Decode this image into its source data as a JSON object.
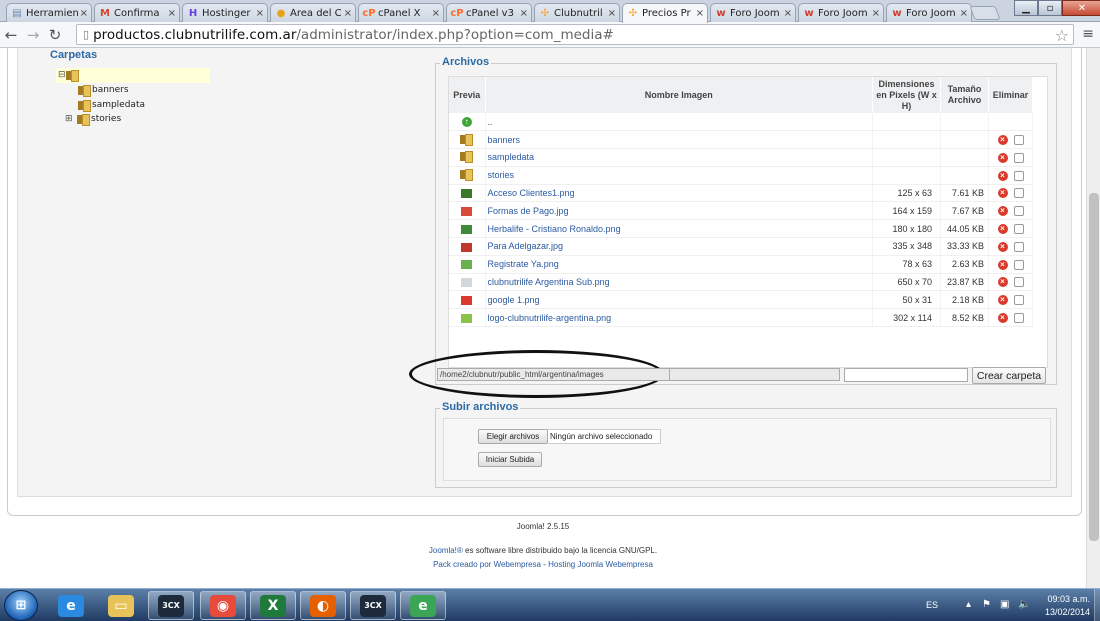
{
  "browser": {
    "tabs": [
      {
        "label": "Herramien",
        "icon": "page-icon",
        "color": "#6b88b5",
        "glyph": "▤"
      },
      {
        "label": "Confirma",
        "icon": "gmail-icon",
        "color": "#d14836",
        "glyph": "M"
      },
      {
        "label": "Hostinger",
        "icon": "hostinger-icon",
        "color": "#673de6",
        "glyph": "H"
      },
      {
        "label": "Área del C",
        "icon": "coin-icon",
        "color": "#e8a21a",
        "glyph": "●"
      },
      {
        "label": "cPanel X",
        "icon": "cpanel-icon",
        "color": "#ff6c2c",
        "glyph": "cP"
      },
      {
        "label": "cPanel v3",
        "icon": "cpanel-icon",
        "color": "#ff6c2c",
        "glyph": "cP"
      },
      {
        "label": "Clubnutril",
        "icon": "joomla-icon",
        "color": "#f9a541",
        "glyph": "✣"
      },
      {
        "label": "Precios Pr",
        "icon": "joomla-icon",
        "color": "#f9a541",
        "glyph": "✣"
      },
      {
        "label": "Foro Joom",
        "icon": "webempresa-icon",
        "color": "#d33b2f",
        "glyph": "w"
      },
      {
        "label": "Foro Joom",
        "icon": "webempresa-icon",
        "color": "#d33b2f",
        "glyph": "w"
      },
      {
        "label": "Foro Joom",
        "icon": "webempresa-icon",
        "color": "#d33b2f",
        "glyph": "w"
      }
    ],
    "url_domain": "productos.clubnutrilife.com.ar",
    "url_path": "/administrator/index.php?option=com_media#"
  },
  "media": {
    "folders_title": "Carpetas",
    "tree": [
      "banners",
      "sampledata",
      "stories"
    ],
    "files_title": "Archivos",
    "columns": {
      "preview": "Previa",
      "name": "Nombre Imagen",
      "dimensions": "Dimensiones en Pixels (W x H)",
      "size": "Tamaño Archivo",
      "delete": "Eliminar"
    },
    "up_label": "..",
    "files": [
      {
        "name": "banners",
        "type": "folder",
        "dim": "",
        "size": ""
      },
      {
        "name": "sampledata",
        "type": "folder",
        "dim": "",
        "size": ""
      },
      {
        "name": "stories",
        "type": "folder",
        "dim": "",
        "size": ""
      },
      {
        "name": "Acceso Clientes1.png",
        "type": "image",
        "dim": "125 x 63",
        "size": "7.61 KB",
        "thumb": "#3a7a2a"
      },
      {
        "name": "Formas de Pago.jpg",
        "type": "image",
        "dim": "164 x 159",
        "size": "7.67 KB",
        "thumb": "#d84a3a"
      },
      {
        "name": "Herbalife - Cristiano Ronaldo.png",
        "type": "image",
        "dim": "180 x 180",
        "size": "44.05 KB",
        "thumb": "#3e8b3a"
      },
      {
        "name": "Para Adelgazar.jpg",
        "type": "image",
        "dim": "335 x 348",
        "size": "33.33 KB",
        "thumb": "#c0392b"
      },
      {
        "name": "Registrate Ya.png",
        "type": "image",
        "dim": "78 x 63",
        "size": "2.63 KB",
        "thumb": "#6ab04c"
      },
      {
        "name": "clubnutrilife Argentina Sub.png",
        "type": "image",
        "dim": "650 x 70",
        "size": "23.87 KB",
        "thumb": "#cfd8dc"
      },
      {
        "name": "google 1.png",
        "type": "image",
        "dim": "50 x 31",
        "size": "2.18 KB",
        "thumb": "#d93a2b"
      },
      {
        "name": "logo-clubnutrilife-argentina.png",
        "type": "image",
        "dim": "302 x 114",
        "size": "8.52 KB",
        "thumb": "#8bc34a"
      }
    ],
    "path_value": "/home2/clubnutr/public_html/argentina/images",
    "create_folder_label": "Crear carpeta",
    "upload_title": "Subir archivos",
    "choose_files_label": "Elegir archivos",
    "no_file_text": "Ningún archivo seleccionado",
    "start_upload_label": "Iniciar Subida"
  },
  "footer": {
    "version": "Joomla! 2.5.15",
    "line2_link": "Joomla!®",
    "line2_text": " es software libre distribuido bajo la licencia GNU/GPL.",
    "line3_a": "Pack creado por Webempresa",
    "line3_sep": " - ",
    "line3_b": "Hosting Joomla Webempresa"
  },
  "taskbar": {
    "apps": [
      {
        "name": "ie-icon",
        "glyph": "e",
        "color": "#2a8ae0"
      },
      {
        "name": "explorer-icon",
        "glyph": "▭",
        "color": "#e8c35a"
      },
      {
        "name": "3cx-icon",
        "glyph": "3CX",
        "color": "#1c2a3a"
      },
      {
        "name": "chrome-icon",
        "glyph": "◉",
        "color": "#e84b3c"
      },
      {
        "name": "excel-icon",
        "glyph": "X",
        "color": "#1f7a3c"
      },
      {
        "name": "firefox-icon",
        "glyph": "◐",
        "color": "#e66000"
      },
      {
        "name": "3cx-icon",
        "glyph": "3CX",
        "color": "#1c2a3a"
      },
      {
        "name": "globe-icon",
        "glyph": "e",
        "color": "#3aa655"
      }
    ],
    "lang": "ES",
    "time": "09:03 a.m.",
    "date": "13/02/2014"
  },
  "colors": {
    "accent": "#2c6aa6",
    "link": "#2a5aa0",
    "delete": "#d93a2b"
  }
}
